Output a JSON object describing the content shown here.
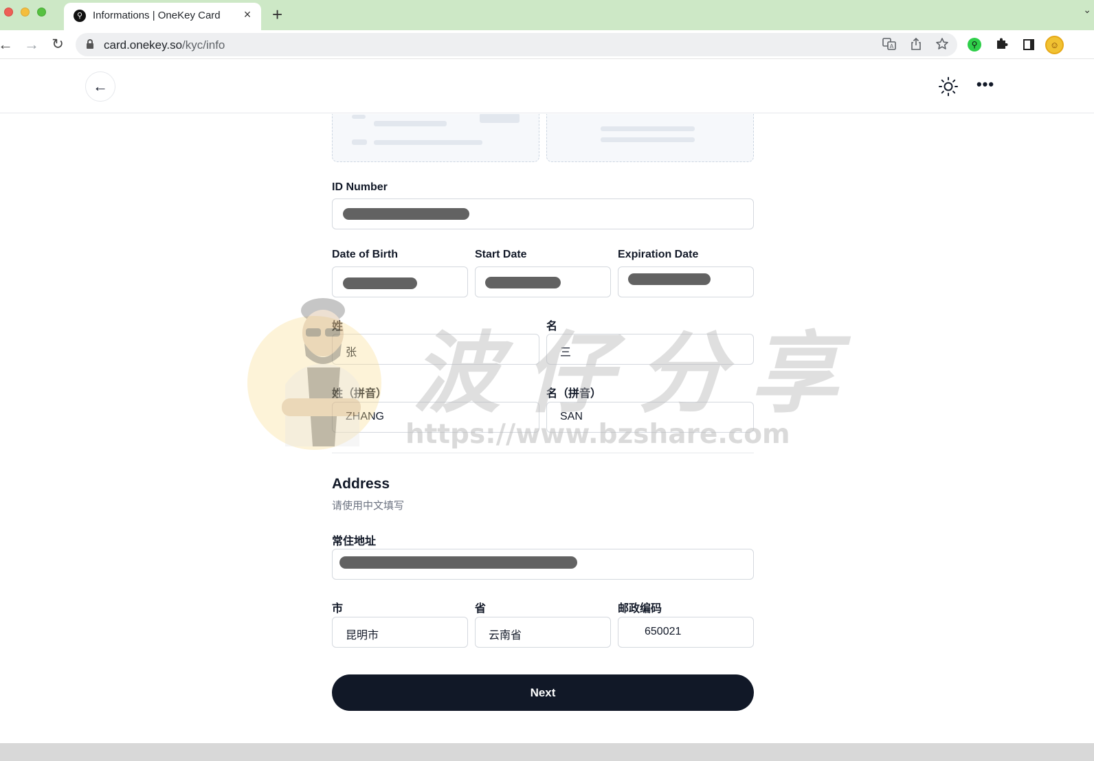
{
  "browser": {
    "tab_title": "Informations | OneKey Card",
    "tab_favicon": "onekey-logo-icon",
    "url_host": "card.onekey.so",
    "url_path": "/kyc/info",
    "tab_close": "×",
    "new_tab": "+",
    "tab_menu": "⌄",
    "back": "←",
    "forward": "→",
    "reload": "↻",
    "icons": [
      "translate-icon",
      "share-icon",
      "bookmark-star-icon",
      "onekey-extension-icon",
      "puzzle-icon",
      "side-panel-icon",
      "profile-avatar-icon"
    ]
  },
  "header": {
    "back_icon": "←",
    "more_icon": "•••",
    "icons": [
      "arrow-left-icon",
      "sun-icon",
      "ellipsis-icon"
    ]
  },
  "form": {
    "id_number": {
      "label": "ID Number",
      "value": ""
    },
    "date_of_birth": {
      "label": "Date of Birth",
      "value": ""
    },
    "start_date": {
      "label": "Start Date",
      "value": ""
    },
    "expiration_date": {
      "label": "Expiration Date",
      "value": ""
    },
    "surname": {
      "label": "姓",
      "value": "张"
    },
    "given_name": {
      "label": "名",
      "value": "三"
    },
    "surname_pinyin": {
      "label": "姓（拼音）",
      "value": "ZHANG"
    },
    "given_name_pinyin": {
      "label": "名（拼音）",
      "value": "SAN"
    }
  },
  "address": {
    "title": "Address",
    "subtitle": "请使用中文填写",
    "street": {
      "label": "常住地址",
      "value": ""
    },
    "city": {
      "label": "市",
      "value": "昆明市"
    },
    "province": {
      "label": "省",
      "value": "云南省"
    },
    "postal_code": {
      "label": "邮政编码",
      "value": "650021"
    }
  },
  "actions": {
    "next_label": "Next"
  },
  "watermark": {
    "text": "波仔分享",
    "url": "https://www.bzshare.com"
  },
  "colors": {
    "primary": "#111827",
    "tab_bar": "#cde8c6",
    "border": "#d4d8de",
    "muted": "#6b7280"
  }
}
